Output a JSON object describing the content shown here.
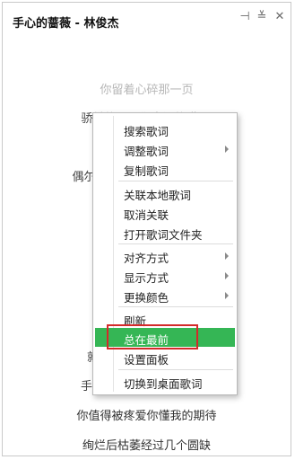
{
  "window": {
    "title": "手心的蔷薇 - 林俊杰",
    "buttons": [
      {
        "name": "pin-icon",
        "glyph": "⊣"
      },
      {
        "name": "minimize-icon",
        "glyph": "≚"
      },
      {
        "name": "close-icon",
        "glyph": "✕"
      }
    ]
  },
  "lyrics": {
    "line1": "你留着心碎那一页",
    "line2": "骄傲的属于你幸福的谎",
    "line3": "偶尔",
    "line4": "就",
    "line5": "手",
    "line6": "你值得被疼爱你懂我的期待",
    "line7": "绚烂后枯萎经过几个圆缺"
  },
  "menu": {
    "search_lyrics": "搜索歌词",
    "adjust_lyrics": "调整歌词",
    "copy_lyrics": "复制歌词",
    "link_local": "关联本地歌词",
    "unlink": "取消关联",
    "open_folder": "打开歌词文件夹",
    "alignment": "对齐方式",
    "display_mode": "显示方式",
    "change_color": "更换颜色",
    "refresh": "刷新",
    "always_on_top": "总在最前",
    "settings_panel": "设置面板",
    "switch_desktop": "切换到桌面歌词"
  },
  "colors": {
    "active_bg": "#35b655",
    "highlight_border": "#d42a2a"
  }
}
